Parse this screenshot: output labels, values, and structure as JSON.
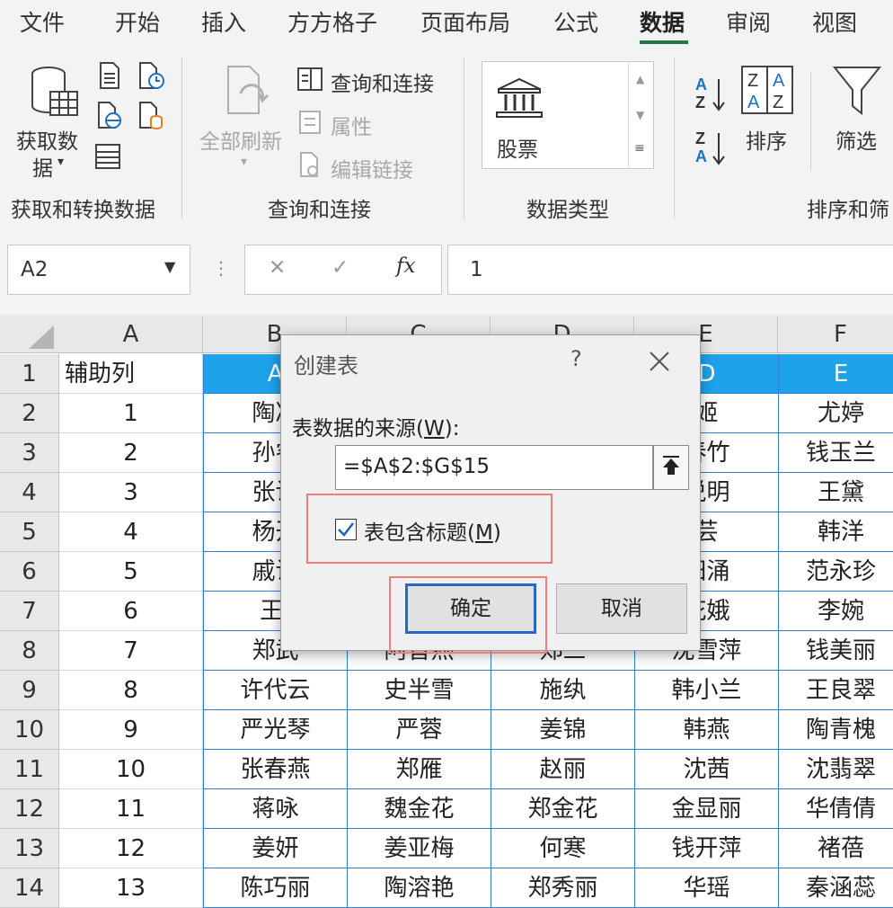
{
  "ribbon": {
    "tabs": [
      "文件",
      "开始",
      "插入",
      "方方格子",
      "页面布局",
      "公式",
      "数据",
      "审阅",
      "视图"
    ],
    "active_tab": "数据",
    "groups": {
      "get_transform": {
        "label": "获取和转换数据",
        "get_data_line1": "获取数",
        "get_data_line2": "据"
      },
      "queries": {
        "label": "查询和连接",
        "refresh_all": "全部刷新",
        "queries_connections": "查询和连接",
        "properties": "属性",
        "edit_links": "编辑链接"
      },
      "data_types": {
        "label": "数据类型",
        "stocks": "股票"
      },
      "sort_filter": {
        "label": "排序和筛",
        "sort": "排序",
        "filter": "筛选"
      }
    }
  },
  "formula_bar": {
    "name_box": "A2",
    "fx": "fx",
    "value": "1"
  },
  "grid": {
    "columns": [
      "A",
      "B",
      "C",
      "D",
      "E",
      "F"
    ],
    "rows": [
      {
        "n": "1",
        "a": "辅助列",
        "b": "A",
        "c": "",
        "d": "",
        "e": "D",
        "f": "E"
      },
      {
        "n": "2",
        "a": "1",
        "b": "陶凌",
        "c": "",
        "d": "",
        "e": "姬",
        "f": "尤婷"
      },
      {
        "n": "3",
        "a": "2",
        "b": "孙睿",
        "c": "",
        "d": "",
        "e": "春竹",
        "f": "钱玉兰"
      },
      {
        "n": "4",
        "a": "3",
        "b": "张访",
        "c": "",
        "d": "",
        "e": "说明",
        "f": "王黛"
      },
      {
        "n": "5",
        "a": "4",
        "b": "杨开",
        "c": "",
        "d": "",
        "e": "芸",
        "f": "韩洋"
      },
      {
        "n": "6",
        "a": "5",
        "b": "戚访",
        "c": "",
        "d": "",
        "e": "阳涌",
        "f": "范永珍"
      },
      {
        "n": "7",
        "a": "6",
        "b": "王/",
        "c": "",
        "d": "",
        "e": "花娥",
        "f": "李婉"
      },
      {
        "n": "8",
        "a": "7",
        "b": "郑武",
        "c": "阿音燕",
        "d": "郑三",
        "e": "沈雪萍",
        "f": "钱美丽"
      },
      {
        "n": "9",
        "a": "8",
        "b": "许代云",
        "c": "史半雪",
        "d": "施纨",
        "e": "韩小兰",
        "f": "王良翠"
      },
      {
        "n": "10",
        "a": "9",
        "b": "严光琴",
        "c": "严蓉",
        "d": "姜锦",
        "e": "韩燕",
        "f": "陶青槐"
      },
      {
        "n": "11",
        "a": "10",
        "b": "张春燕",
        "c": "郑雁",
        "d": "赵丽",
        "e": "沈茜",
        "f": "沈翡翠"
      },
      {
        "n": "12",
        "a": "11",
        "b": "蒋咏",
        "c": "魏金花",
        "d": "郑金花",
        "e": "金显丽",
        "f": "华倩倩"
      },
      {
        "n": "13",
        "a": "12",
        "b": "姜妍",
        "c": "姜亚梅",
        "d": "何寒",
        "e": "钱开萍",
        "f": "褚蓓"
      },
      {
        "n": "14",
        "a": "13",
        "b": "陈巧丽",
        "c": "陶溶艳",
        "d": "郑秀丽",
        "e": "华瑶",
        "f": "秦涵蕊"
      }
    ]
  },
  "dialog": {
    "title": "创建表",
    "help": "?",
    "source_label": "表数据的来源(",
    "source_key": "W",
    "source_label_end": "):",
    "source_value": "=$A$2:$G$15",
    "has_headers_label": "表包含标题(",
    "has_headers_key": "M",
    "has_headers_end": ")",
    "has_headers_checked": true,
    "ok": "确定",
    "cancel": "取消"
  },
  "colors": {
    "accent_green": "#1f7a43",
    "table_header": "#1ea2ea",
    "table_border": "#2e7fd6",
    "highlight_red": "#ef7d7d",
    "button_focus": "#2a66c8"
  }
}
